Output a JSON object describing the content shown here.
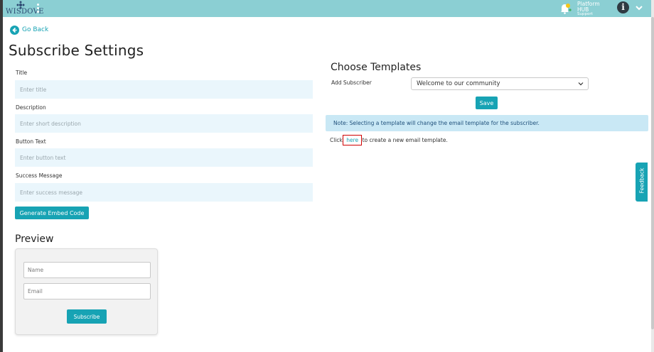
{
  "app": {
    "logo_text": "WISDOVE",
    "platform_title": "Platform HUB",
    "platform_sub": "Support",
    "info_glyph": "i"
  },
  "colors": {
    "accent": "#17a3b4",
    "header": "#8bcfd3",
    "input_bg": "#eaf6fc",
    "note_bg": "#c9e8f5"
  },
  "nav": {
    "go_back": "Go Back"
  },
  "page": {
    "title": "Subscribe Settings"
  },
  "form": {
    "title": {
      "label": "Title",
      "placeholder": "Enter title",
      "value": ""
    },
    "description": {
      "label": "Description",
      "placeholder": "Enter short description",
      "value": ""
    },
    "button_text": {
      "label": "Button Text",
      "placeholder": "Enter button text",
      "value": ""
    },
    "success_message": {
      "label": "Success Message",
      "placeholder": "Enter success message",
      "value": ""
    },
    "generate_button": "Generate Embed Code"
  },
  "preview": {
    "title": "Preview",
    "name_placeholder": "Name",
    "email_placeholder": "Email",
    "subscribe_button": "Subscribe"
  },
  "templates": {
    "title": "Choose Templates",
    "add_subscriber_label": "Add Subscriber",
    "selected_template": "Welcome to our community",
    "save_button": "Save",
    "note": "Note: Selecting a template will change the email template for the subscriber.",
    "click_prefix": "Click",
    "here_link": "here",
    "click_suffix": "to create a new email template."
  },
  "feedback": {
    "label": "Feedback"
  }
}
